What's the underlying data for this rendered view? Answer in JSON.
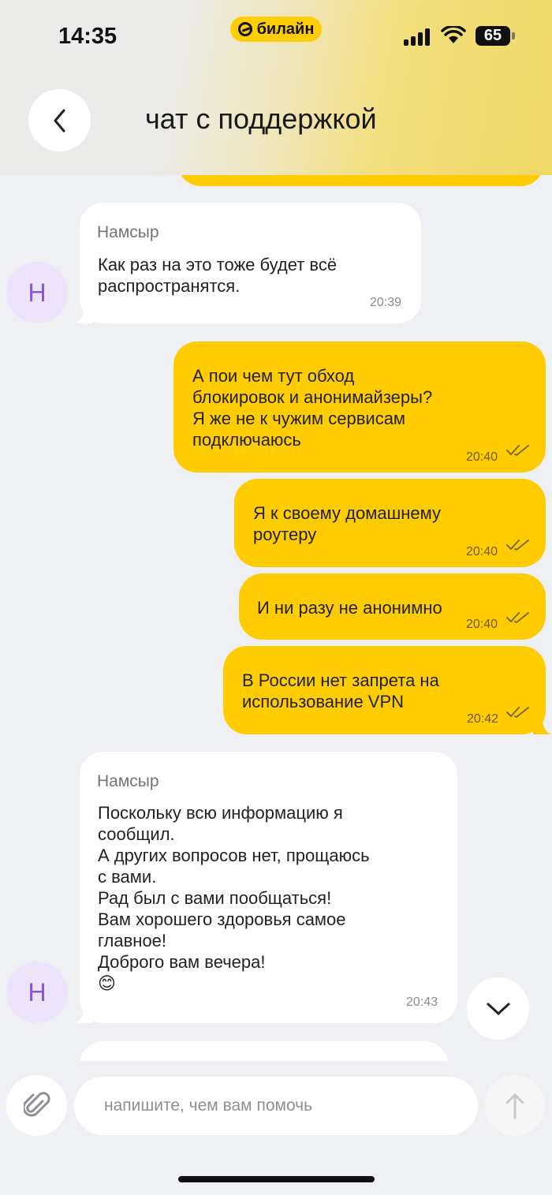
{
  "status_bar": {
    "time": "14:35",
    "carrier": "билайн",
    "battery": "65"
  },
  "header": {
    "title": "чат с поддержкой"
  },
  "colors": {
    "brand_yellow": "#fecc00",
    "avatar_bg": "#ede4fb",
    "avatar_letter": "#8a55de"
  },
  "messages": [
    {
      "direction": "in",
      "sender": "Намсыр",
      "avatar_letter": "Н",
      "text": "Как раз на это тоже будет всё\nраспространятся.",
      "time": "20:39"
    },
    {
      "direction": "out",
      "text": "А пои чем тут обход\nблокировок и анонимайзеры?\nЯ же не к чужим сервисам\nподключаюсь",
      "time": "20:40",
      "status_icon": "double-check-icon"
    },
    {
      "direction": "out",
      "text": "Я к своему домашнему\nроутеру",
      "time": "20:40",
      "status_icon": "double-check-icon"
    },
    {
      "direction": "out",
      "text": "И ни разу не анонимно",
      "time": "20:40",
      "status_icon": "double-check-icon"
    },
    {
      "direction": "out",
      "text": "В России нет запрета на\nиспользование VPN",
      "time": "20:42",
      "status_icon": "double-check-icon"
    },
    {
      "direction": "in",
      "sender": "Намсыр",
      "avatar_letter": "Н",
      "text": "Поскольку всю информацию я\nсообщил.\nА других вопросов нет, прощаюсь\nс вами.\nРад был с вами пообщаться!\nВам хорошего здоровья самое\nглавное!\nДоброго вам вечера!\n😊",
      "time": "20:43"
    }
  ],
  "composer": {
    "placeholder": "напишите, чем вам помочь",
    "value": ""
  }
}
